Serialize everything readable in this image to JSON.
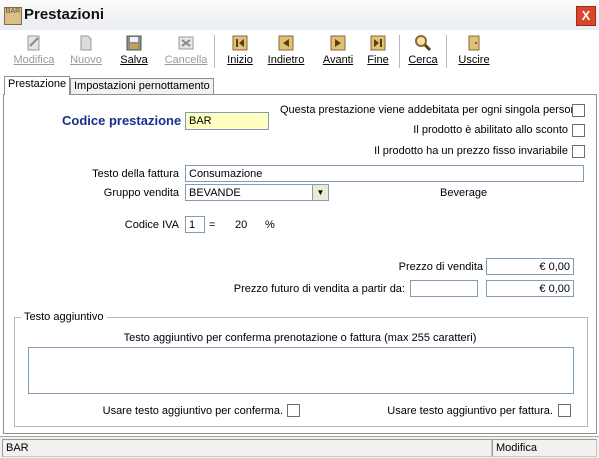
{
  "window": {
    "title": "Prestazioni",
    "app_icon": "BAR",
    "close_label": "X"
  },
  "toolbar": {
    "modifica": "Modifica",
    "nuovo": "Nuovo",
    "salva": "Salva",
    "cancella": "Cancella",
    "inizio": "Inizio",
    "indietro": "Indietro",
    "avanti": "Avanti",
    "fine": "Fine",
    "cerca": "Cerca",
    "uscire": "Uscire"
  },
  "tabs": {
    "prestazione": "Prestazione",
    "impostazioni": "Impostazioni pernottamento"
  },
  "form": {
    "codice_label": "Codice prestazione",
    "codice_value": "BAR",
    "opt_persona": "Questa prestazione viene addebitata per ogni singola persona",
    "opt_sconto": "Il prodotto è abilitato allo sconto",
    "opt_prezzo_fisso": "Il prodotto ha un prezzo fisso invariabile",
    "testo_fattura_label": "Testo della fattura",
    "testo_fattura_value": "Consumazione",
    "gruppo_label": "Gruppo vendita",
    "gruppo_value": "BEVANDE",
    "gruppo_desc": "Beverage",
    "iva_label": "Codice IVA",
    "iva_value": "1",
    "iva_equals": "=",
    "iva_rate": "20",
    "iva_percent": "%",
    "prezzo_label": "Prezzo di vendita",
    "prezzo_value": "€ 0,00",
    "prezzo_futuro_label": "Prezzo futuro di vendita a partir da:",
    "prezzo_futuro_date": "",
    "prezzo_futuro_value": "€ 0,00"
  },
  "testo_aggiuntivo": {
    "group_title": "Testo aggiuntivo",
    "caption": "Testo aggiuntivo per conferma prenotazione o fattura (max 255 caratteri)",
    "text": "",
    "use_conferma": "Usare testo aggiuntivo per conferma.",
    "use_fattura": "Usare testo aggiuntivo per fattura."
  },
  "status": {
    "left": "BAR",
    "right": "Modifica"
  },
  "colors": {
    "codice_label": "#1b2f8a",
    "codice_field_bg": "#ffffc0",
    "close_red": "#d8462e"
  }
}
